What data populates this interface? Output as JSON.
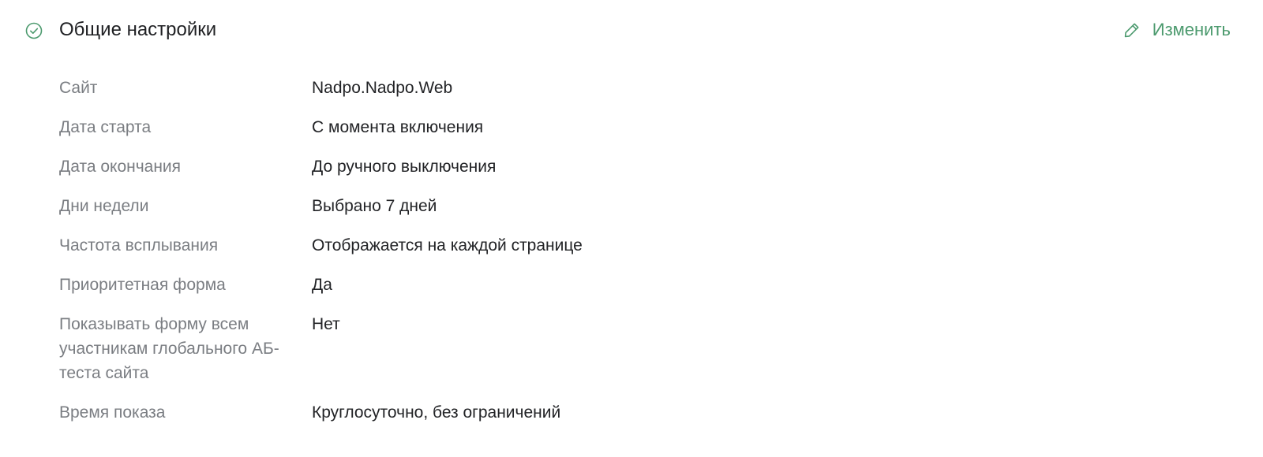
{
  "section": {
    "title": "Общие настройки",
    "status_icon": "check-circle-icon",
    "edit_icon": "pencil-icon",
    "edit_label": "Изменить",
    "accent_color": "#4c9a6e"
  },
  "rows": [
    {
      "label": "Сайт",
      "value": "Nadpo.Nadpo.Web"
    },
    {
      "label": "Дата старта",
      "value": "С момента включения"
    },
    {
      "label": "Дата окончания",
      "value": "До ручного выключения"
    },
    {
      "label": "Дни недели",
      "value": "Выбрано 7 дней"
    },
    {
      "label": "Частота всплывания",
      "value": "Отображается на каждой странице"
    },
    {
      "label": "Приоритетная форма",
      "value": "Да"
    },
    {
      "label": "Показывать форму всем участникам глобального АБ-теста сайта",
      "value": "Нет"
    },
    {
      "label": "Время показа",
      "value": "Круглосуточно, без ограничений"
    }
  ]
}
